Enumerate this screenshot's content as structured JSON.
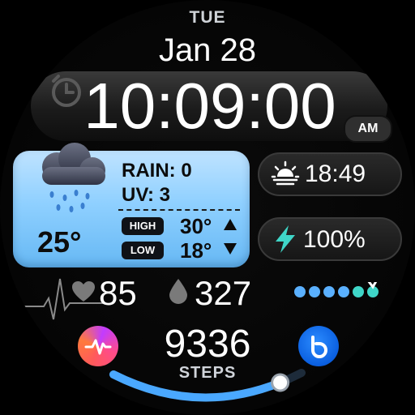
{
  "header": {
    "day": "TUE",
    "date": "Jan 28"
  },
  "time": {
    "value": "10:09:00",
    "ampm": "AM",
    "alarm_icon": "alarm-icon"
  },
  "weather": {
    "rain_label": "RAIN: 0",
    "uv_label": "UV: 3",
    "current_temp": "25°",
    "high_label": "HIGH",
    "high_value": "30°",
    "low_label": "LOW",
    "low_value": "18°",
    "icon": "rain-cloud-icon"
  },
  "sunrise": {
    "time": "18:49",
    "icon": "sunset-icon"
  },
  "battery": {
    "percent": "100%",
    "icon": "bolt-icon"
  },
  "health": {
    "heart_rate": "85",
    "water": "327",
    "dots_filled": 5,
    "steps": "9336",
    "steps_label": "STEPS",
    "steps_progress": 0.88
  },
  "colors": {
    "accent_blue": "#5ab0ff",
    "teal": "#3fd6c8",
    "weather_bg": "#8fd0ff"
  }
}
